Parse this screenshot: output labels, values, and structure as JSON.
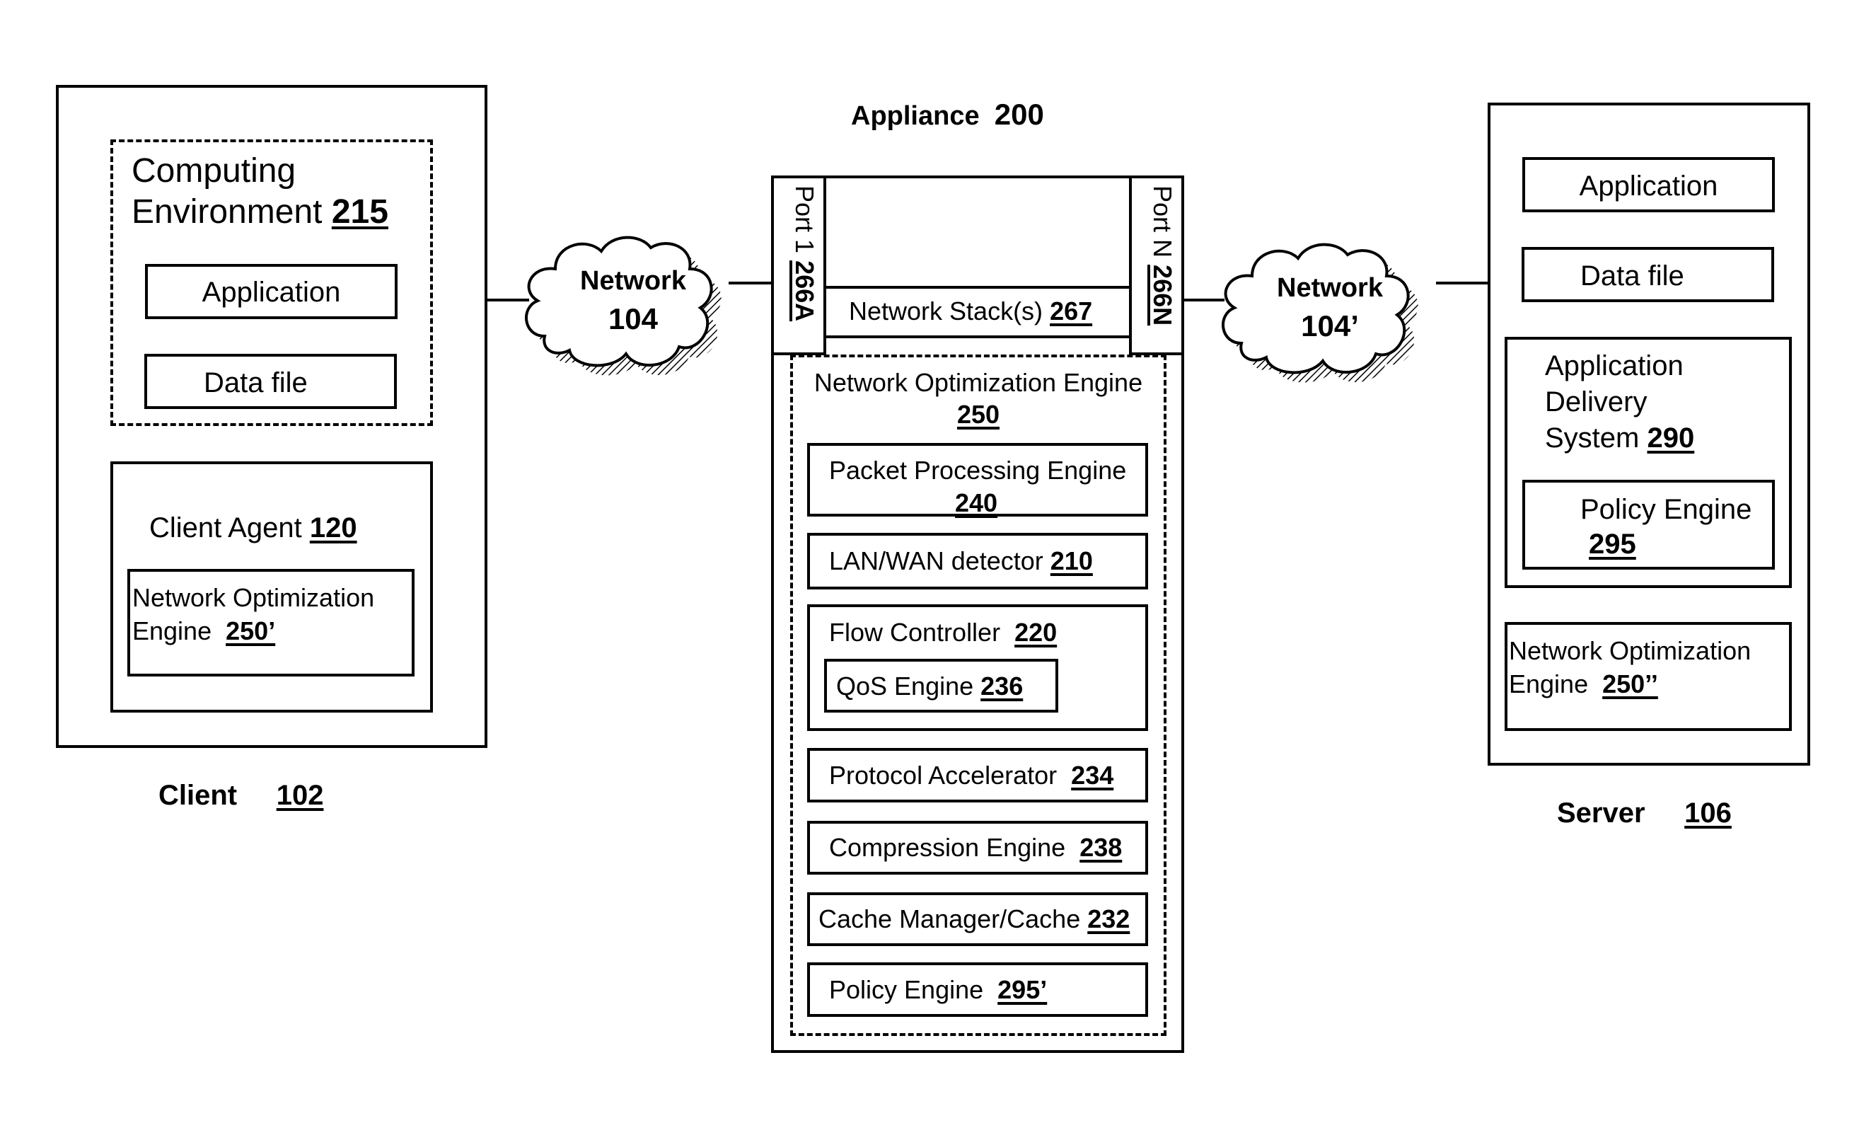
{
  "client": {
    "label": "Client",
    "ref": "102",
    "computing_environment": {
      "label_line1": "Computing",
      "label_line2": "Environment",
      "ref": "215",
      "application_label": "Application",
      "data_file_label": "Data file"
    },
    "client_agent": {
      "label": "Client Agent",
      "ref": "120",
      "noe": {
        "label_line1": "Network Optimization",
        "label_line2": "Engine",
        "ref": "250’"
      }
    }
  },
  "networks": [
    {
      "label": "Network",
      "ref": "104"
    },
    {
      "label": "Network",
      "ref": "104’"
    }
  ],
  "appliance": {
    "label": "Appliance",
    "ref": "200",
    "port_left": {
      "label": "Port 1",
      "ref": "266A"
    },
    "port_right": {
      "label": "Port N",
      "ref": "266N"
    },
    "network_stack": {
      "label": "Network Stack(s)",
      "ref": "267"
    },
    "noe": {
      "label": "Network Optimization Engine",
      "ref": "250",
      "components": [
        {
          "label": "Packet Processing Engine",
          "ref": "240"
        },
        {
          "label": "LAN/WAN detector",
          "ref": "210"
        },
        {
          "label": "Flow Controller",
          "ref": "220",
          "child": {
            "label": "QoS Engine",
            "ref": "236"
          }
        },
        {
          "label": "Protocol Accelerator",
          "ref": "234"
        },
        {
          "label": "Compression Engine",
          "ref": "238"
        },
        {
          "label": "Cache Manager/Cache",
          "ref": "232"
        },
        {
          "label": "Policy Engine",
          "ref": "295’"
        }
      ]
    }
  },
  "server": {
    "label": "Server",
    "ref": "106",
    "application_label": "Application",
    "data_file_label": "Data file",
    "ads": {
      "label_line1": "Application",
      "label_line2": "Delivery",
      "label_line3": "System",
      "ref": "290",
      "policy_engine": {
        "label": "Policy Engine",
        "ref": "295"
      }
    },
    "noe": {
      "label_line1": "Network Optimization",
      "label_line2": "Engine",
      "ref": "250’’"
    }
  }
}
